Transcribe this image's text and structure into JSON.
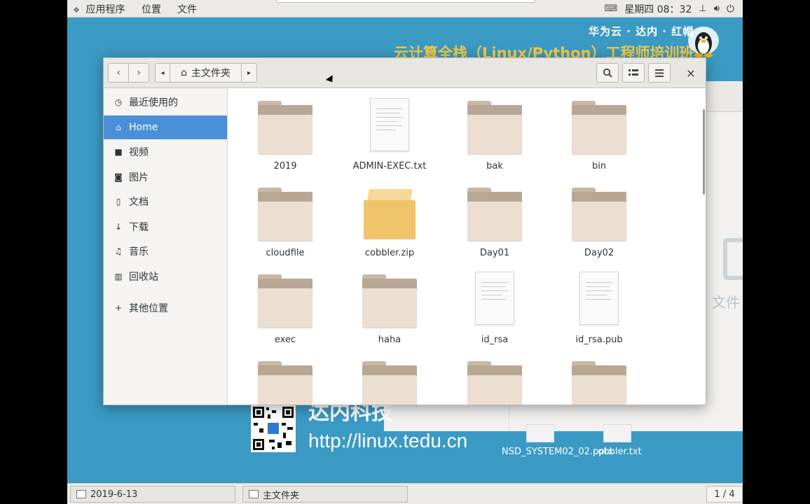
{
  "topbar": {
    "apps_menu": "应用程序",
    "places_menu": "位置",
    "file_menu": "文件",
    "datetime": "星期四 08：32"
  },
  "desktop": {
    "banner_line1": "华为云 · 达内 · 红帽",
    "banner_line2": "云计算全栈（Linux/Python）工程师培训班",
    "brand_partial": "达内科技",
    "url": "http://linux.tedu.cn",
    "bg_window_label": "文件",
    "files": [
      {
        "name": "NSD_SYSTEM02_02.pptx"
      },
      {
        "name": "cobbler.txt"
      }
    ]
  },
  "window": {
    "path_home": "主文件夹",
    "sidebar": [
      {
        "label": "最近使用的",
        "icon": "clock-icon"
      },
      {
        "label": "Home",
        "icon": "home-icon",
        "active": true
      },
      {
        "label": "视频",
        "icon": "video-icon"
      },
      {
        "label": "图片",
        "icon": "camera-icon"
      },
      {
        "label": "文档",
        "icon": "document-icon"
      },
      {
        "label": "下载",
        "icon": "download-icon"
      },
      {
        "label": "音乐",
        "icon": "music-icon"
      },
      {
        "label": "回收站",
        "icon": "trash-icon"
      },
      {
        "label": "其他位置",
        "icon": "plus-icon"
      }
    ],
    "items": [
      {
        "name": "2019",
        "type": "folder"
      },
      {
        "name": "ADMIN-EXEC.txt",
        "type": "text"
      },
      {
        "name": "bak",
        "type": "folder"
      },
      {
        "name": "bin",
        "type": "folder"
      },
      {
        "name": "cloudfile",
        "type": "folder"
      },
      {
        "name": "cobbler.zip",
        "type": "archive"
      },
      {
        "name": "Day01",
        "type": "folder"
      },
      {
        "name": "Day02",
        "type": "folder"
      },
      {
        "name": "exec",
        "type": "folder"
      },
      {
        "name": "haha",
        "type": "folder"
      },
      {
        "name": "id_rsa",
        "type": "text"
      },
      {
        "name": "id_rsa.pub",
        "type": "text"
      },
      {
        "name": "",
        "type": "folder"
      },
      {
        "name": "",
        "type": "folder"
      },
      {
        "name": "",
        "type": "folder"
      },
      {
        "name": "",
        "type": "folder"
      }
    ]
  },
  "taskbar": {
    "task1": "2019-6-13",
    "task2": "主文件夹",
    "pager": "1 / 4"
  }
}
